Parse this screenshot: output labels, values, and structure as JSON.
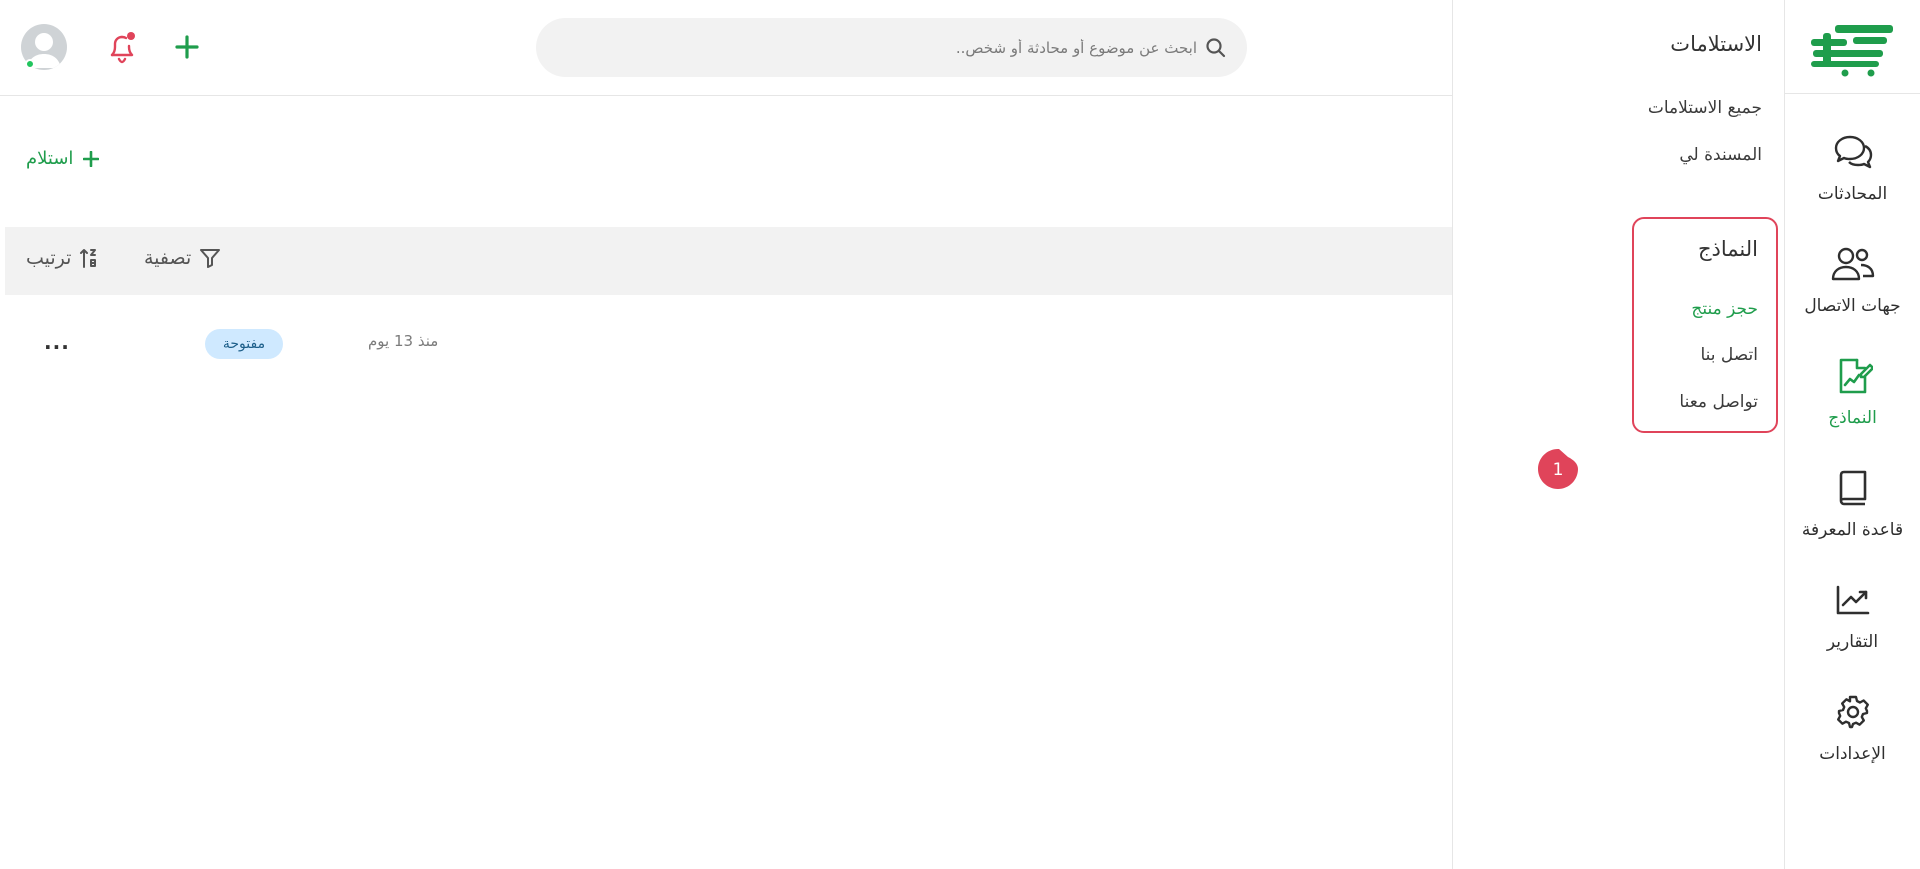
{
  "colors": {
    "accent": "#1f9d4c",
    "highlight": "#e0445a",
    "badge_bg": "#cfe9ff",
    "notification": "#e0445a",
    "online": "#22c55e"
  },
  "rail": {
    "logo_icon": "brand-logo-icon",
    "items": [
      {
        "label": "المحادثات",
        "icon": "chat-bubbles-icon"
      },
      {
        "label": "جهات الاتصال",
        "icon": "contacts-icon"
      },
      {
        "label": "النماذج",
        "icon": "forms-icon",
        "active": true
      },
      {
        "label": "قاعدة المعرفة",
        "icon": "book-icon"
      },
      {
        "label": "التقارير",
        "icon": "chart-icon"
      },
      {
        "label": "الإعدادات",
        "icon": "gear-icon"
      }
    ]
  },
  "subpanel": {
    "title": "الاستلامات",
    "links": [
      "جميع الاستلامات",
      "المسندة لي"
    ],
    "forms_section": {
      "title": "النماذج",
      "items": [
        {
          "label": "حجز منتج",
          "active": true
        },
        {
          "label": "اتصل بنا"
        },
        {
          "label": "تواصل معنا"
        }
      ]
    }
  },
  "callout": {
    "number": "1"
  },
  "header": {
    "search_placeholder": "ابحث عن موضوع أو محادثة أو شخص..",
    "search_icon": "search-icon",
    "add_icon": "plus-icon",
    "notification_icon": "bell-icon",
    "avatar_icon": "user-avatar-icon"
  },
  "toolbar": {
    "add_label": "استلام",
    "filter_label": "تصفية",
    "sort_label": "ترتيب"
  },
  "submissions": [
    {
      "time": "منذ 13 يوم",
      "status": "مفتوحة",
      "more": "..."
    }
  ]
}
